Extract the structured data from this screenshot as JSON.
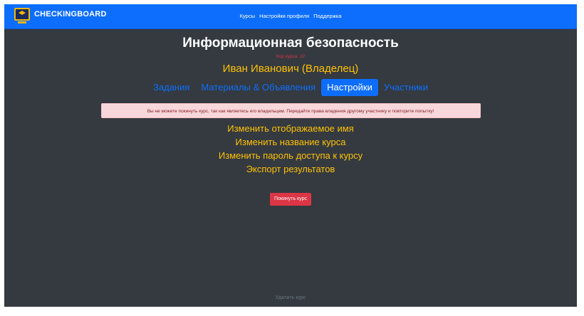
{
  "navbar": {
    "brand": "CHECKINGBOARD",
    "links": [
      "Курсы",
      "Настройки профиля",
      "Поддержка"
    ]
  },
  "course": {
    "title": "Информационная безопасность",
    "code_label": "Код курса: 22",
    "owner": "Иван Иванович (Владелец)"
  },
  "tabs": [
    {
      "label": "Задания",
      "active": false
    },
    {
      "label": "Материалы & Объявления",
      "active": false
    },
    {
      "label": "Настройки",
      "active": true
    },
    {
      "label": "Участники",
      "active": false
    }
  ],
  "alert": {
    "text": "Вы не можете покинуть курс, так как являетесь его владельцем. Передайте права владения другому участнику и повторите попытку!"
  },
  "settings": {
    "links": [
      "Изменить отображаемое имя",
      "Изменить название курса",
      "Изменить пароль доступа к курсу",
      "Экспорт результатов"
    ],
    "leave_button": "Покинуть курс",
    "delete_link": "Удалить курс"
  },
  "colors": {
    "navbar": "#0d6efd",
    "background": "#343a40",
    "accent": "#ffc107",
    "danger": "#dc3545"
  }
}
